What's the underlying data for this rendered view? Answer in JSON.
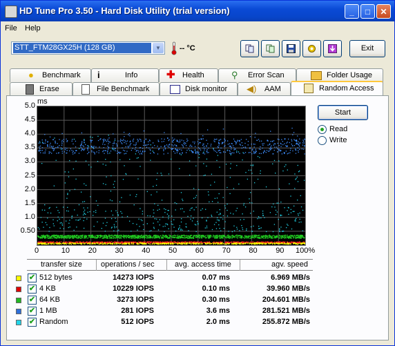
{
  "window": {
    "title": "HD Tune Pro 3.50 - Hard Disk Utility (trial version)"
  },
  "menu": {
    "file": "File",
    "help": "Help"
  },
  "toolbar": {
    "drive": "STT_FTM28GX25H (128 GB)",
    "temperature": "-- °C",
    "exit_label": "Exit"
  },
  "tabs_top": [
    {
      "label": "Benchmark",
      "icon": "lightbulb-icon"
    },
    {
      "label": "Info",
      "icon": "info-icon"
    },
    {
      "label": "Health",
      "icon": "health-cross-icon"
    },
    {
      "label": "Error Scan",
      "icon": "magnifier-icon"
    },
    {
      "label": "Folder Usage",
      "icon": "folder-icon"
    }
  ],
  "tabs_bottom": [
    {
      "label": "Erase",
      "icon": "trash-icon"
    },
    {
      "label": "File Benchmark",
      "icon": "file-benchmark-icon"
    },
    {
      "label": "Disk monitor",
      "icon": "disk-monitor-icon"
    },
    {
      "label": "AAM",
      "icon": "speaker-icon"
    },
    {
      "label": "Random Access",
      "icon": "random-access-icon",
      "active": true
    }
  ],
  "chart_data": {
    "type": "scatter",
    "ylabel": "ms",
    "ylim": [
      0,
      5.0
    ],
    "xlim": [
      0,
      100
    ],
    "y_ticks": [
      "5.0",
      "4.5",
      "4.0",
      "3.5",
      "3.0",
      "2.5",
      "2.0",
      "1.5",
      "1.0",
      "0.50"
    ],
    "x_ticks": [
      "0",
      "10",
      "20",
      "30",
      "40",
      "50",
      "60",
      "70",
      "80",
      "90",
      "100%"
    ],
    "grid": true,
    "series": [
      {
        "name": "512 bytes",
        "color": "#ffff00",
        "band": [
          0.05,
          0.12
        ]
      },
      {
        "name": "4 KB",
        "color": "#ff2020",
        "band": [
          0.08,
          0.14
        ]
      },
      {
        "name": "64 KB",
        "color": "#22cc22",
        "band": [
          0.25,
          0.38
        ]
      },
      {
        "name": "1 MB",
        "color": "#3f8fff",
        "band": [
          3.3,
          4.0
        ]
      },
      {
        "name": "Random",
        "color": "#22d4e8",
        "band": [
          0.5,
          4.3
        ]
      }
    ]
  },
  "controls": {
    "start_label": "Start",
    "read_label": "Read",
    "write_label": "Write",
    "mode": "Read"
  },
  "results": {
    "headers": [
      "transfer size",
      "operations / sec",
      "avg. access time",
      "agv. speed"
    ],
    "rows": [
      {
        "size": "512 bytes",
        "ops": "14273 IOPS",
        "access": "0.07 ms",
        "speed": "6.969 MB/s",
        "color": "#ffff00"
      },
      {
        "size": "4 KB",
        "ops": "10229 IOPS",
        "access": "0.10 ms",
        "speed": "39.960 MB/s",
        "color": "#e00000"
      },
      {
        "size": "64 KB",
        "ops": "3273 IOPS",
        "access": "0.30 ms",
        "speed": "204.601 MB/s",
        "color": "#22b822"
      },
      {
        "size": "1 MB",
        "ops": "281 IOPS",
        "access": "3.6 ms",
        "speed": "281.521 MB/s",
        "color": "#2f6fd8"
      },
      {
        "size": "Random",
        "ops": "512 IOPS",
        "access": "2.0 ms",
        "speed": "255.872 MB/s",
        "color": "#22d4e8"
      }
    ]
  }
}
